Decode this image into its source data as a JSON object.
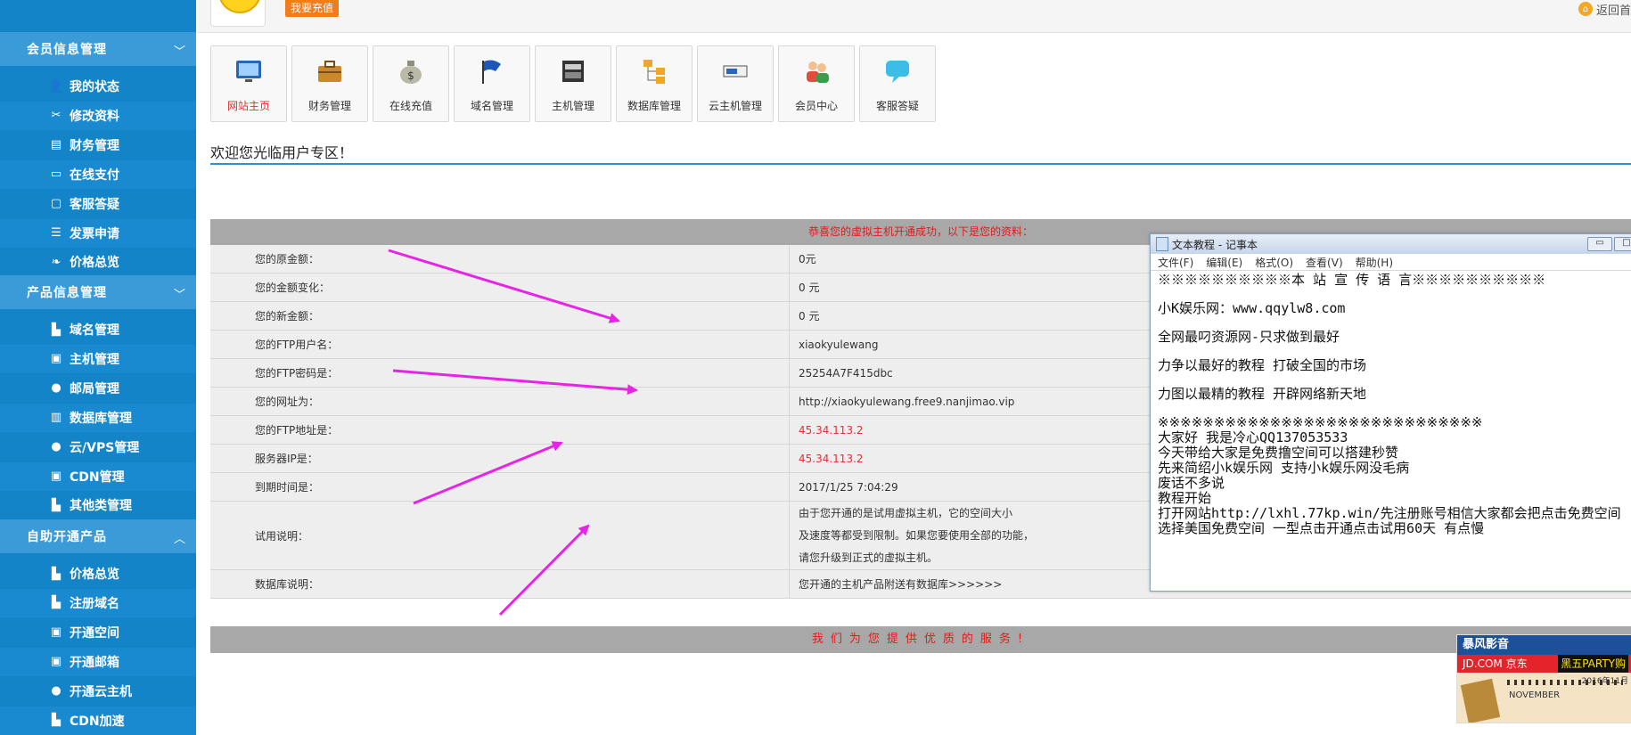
{
  "sidebar": {
    "sections": [
      {
        "title": "会员信息管理",
        "chevron": "chevron-down",
        "items": [
          {
            "label": "我的状态",
            "icon": "user-icon"
          },
          {
            "label": "修改资料",
            "icon": "tools-icon"
          },
          {
            "label": "财务管理",
            "icon": "database-icon"
          },
          {
            "label": "在线支付",
            "icon": "monitor-icon"
          },
          {
            "label": "客服答疑",
            "icon": "chat-icon"
          },
          {
            "label": "发票申请",
            "icon": "list-icon"
          },
          {
            "label": "价格总览",
            "icon": "leaf-icon"
          }
        ]
      },
      {
        "title": "产品信息管理",
        "chevron": "chevron-down",
        "items": [
          {
            "label": "域名管理",
            "icon": "book-icon"
          },
          {
            "label": "主机管理",
            "icon": "server-icon"
          },
          {
            "label": "邮局管理",
            "icon": "pin-icon"
          },
          {
            "label": "数据库管理",
            "icon": "bar-chart-icon"
          },
          {
            "label": "云/VPS管理",
            "icon": "pin-icon"
          },
          {
            "label": "CDN管理",
            "icon": "server-icon"
          },
          {
            "label": "其他类管理",
            "icon": "book-icon"
          }
        ]
      },
      {
        "title": "自助开通产品",
        "chevron": "chevron-up",
        "items": [
          {
            "label": "价格总览",
            "icon": "book-icon"
          },
          {
            "label": "注册域名",
            "icon": "book-icon"
          },
          {
            "label": "开通空间",
            "icon": "server-icon"
          },
          {
            "label": "开通邮箱",
            "icon": "server-icon"
          },
          {
            "label": "开通云主机",
            "icon": "pin-icon"
          },
          {
            "label": "CDN加速",
            "icon": "book-icon"
          }
        ]
      }
    ]
  },
  "topbar": {
    "recharge_label": "我要充值",
    "home_label": "返回首"
  },
  "tiles": [
    {
      "label": "网站主页",
      "icon": "website-icon",
      "active": true
    },
    {
      "label": "财务管理",
      "icon": "briefcase-icon"
    },
    {
      "label": "在线充值",
      "icon": "money-bag-icon"
    },
    {
      "label": "域名管理",
      "icon": "flag-icon"
    },
    {
      "label": "主机管理",
      "icon": "host-icon"
    },
    {
      "label": "数据库管理",
      "icon": "folders-icon"
    },
    {
      "label": "云主机管理",
      "icon": "server-rack-icon"
    },
    {
      "label": "会员中心",
      "icon": "members-icon"
    },
    {
      "label": "客服答疑",
      "icon": "speech-bubble-icon"
    }
  ],
  "welcome": "欢迎您光临用户专区！",
  "info": {
    "header": "恭喜您的虚拟主机开通成功，以下是您的资料：",
    "rows": [
      {
        "label": "您的原金额：",
        "value": "0元"
      },
      {
        "label": "您的金额变化：",
        "value": "0 元"
      },
      {
        "label": "您的新金额：",
        "value": "0 元"
      },
      {
        "label": "您的FTP用户名：",
        "value": "xiaokyulewang"
      },
      {
        "label": "您的FTP密码是：",
        "value": "25254A7F415dbc"
      },
      {
        "label": "您的网址为：",
        "value": "http://xiaokyulewang.free9.nanjimao.vip"
      },
      {
        "label": "您的FTP地址是：",
        "value": "45.34.113.2",
        "red": true
      },
      {
        "label": "服务器IP是：",
        "value": "45.34.113.2",
        "red": true
      },
      {
        "label": "到期时间是：",
        "value": "2017/1/25 7:04:29"
      }
    ],
    "trial": {
      "label": "试用说明：",
      "lines": [
        "由于您开通的是试用虚拟主机，它的空间大小",
        "及速度等都受到限制。如果您要使用全部的功能，",
        "请您升级到正式的虚拟主机。"
      ]
    },
    "db": {
      "label": "数据库说明：",
      "value": "您开通的主机产品附送有数据库>>>>>>"
    },
    "footer": "我们为您提供优质的服务!"
  },
  "notepad": {
    "title": "文本教程 - 记事本",
    "menu": [
      "文件(F)",
      "编辑(E)",
      "格式(O)",
      "查看(V)",
      "帮助(H)"
    ],
    "lines": [
      "※※※※※※※※※※本 站 宣 传 语 言※※※※※※※※※※",
      "",
      "小K娱乐网：www.qqylw8.com",
      "",
      "全网最叼资源网-只求做到最好",
      "",
      "力争以最好的教程 打破全国的市场",
      "",
      "力图以最精的教程 开辟网络新天地",
      "",
      "※※※※※※※※※※※※※※※※※※※※※※※※※※※※※",
      "大家好 我是冷心QQ137053533",
      "今天带给大家是免费撸空间可以搭建秒赞",
      "先来简绍小k娱乐网 支持小k娱乐网没毛病",
      "废话不多说",
      "教程开始",
      "打开网站http://lxhl.77kp.win/先注册账号相信大家都会把点击免费空间",
      "选择美国免费空间 一型点击开通点击试用60天 有点慢"
    ]
  },
  "ad": {
    "brand": "暴风影音",
    "jd": "JD.COM 京东",
    "party": "黑五PARTY购",
    "month": "NOVEMBER",
    "year": "2016年11月"
  },
  "colors": {
    "sidebar": "#1484c8",
    "section": "#3b9bd8",
    "accent_line": "#2f8fd3",
    "arrow": "#e624e6",
    "highlight_red": "#e23030"
  }
}
